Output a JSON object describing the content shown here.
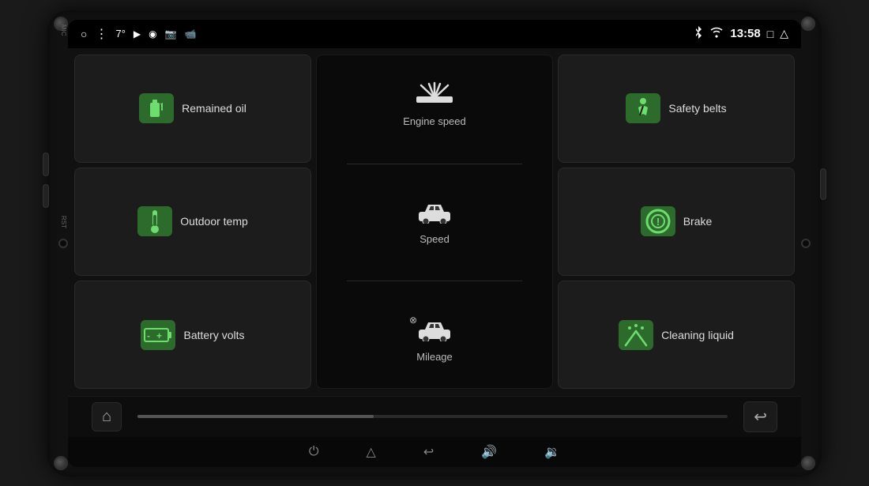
{
  "device": {
    "mic_label": "MIC",
    "rst_label": "RST"
  },
  "status_bar": {
    "temperature": "7°",
    "time": "13:58",
    "icons": [
      "circle",
      "dots",
      "video",
      "photo",
      "camera",
      "video2",
      "bluetooth",
      "wifi",
      "square",
      "back"
    ]
  },
  "tiles": [
    {
      "id": "remained-oil",
      "label": "Remained oil",
      "icon": "fuel",
      "col": 1,
      "row": 1
    },
    {
      "id": "outdoor-temp",
      "label": "Outdoor temp",
      "icon": "thermometer",
      "col": 1,
      "row": 2
    },
    {
      "id": "battery-volts",
      "label": "Battery volts",
      "icon": "battery",
      "col": 1,
      "row": 3
    },
    {
      "id": "safety-belts",
      "label": "Safety belts",
      "icon": "seatbelt",
      "col": 3,
      "row": 1
    },
    {
      "id": "brake",
      "label": "Brake",
      "icon": "brake",
      "col": 3,
      "row": 2
    },
    {
      "id": "cleaning-liquid",
      "label": "Cleaning liquid",
      "icon": "wiper",
      "col": 3,
      "row": 3
    }
  ],
  "center": {
    "sections": [
      {
        "id": "engine-speed",
        "label": "Engine speed",
        "icon": "wiper_gauge"
      },
      {
        "id": "speed",
        "label": "Speed",
        "icon": "car_top"
      },
      {
        "id": "mileage",
        "label": "Mileage",
        "icon": "car_mileage"
      }
    ]
  },
  "bottom_nav": {
    "home_icon": "⌂",
    "back_icon": "↩"
  },
  "system_bar": {
    "buttons": [
      "⏻",
      "△",
      "↩",
      "🔊",
      "🔇"
    ]
  }
}
